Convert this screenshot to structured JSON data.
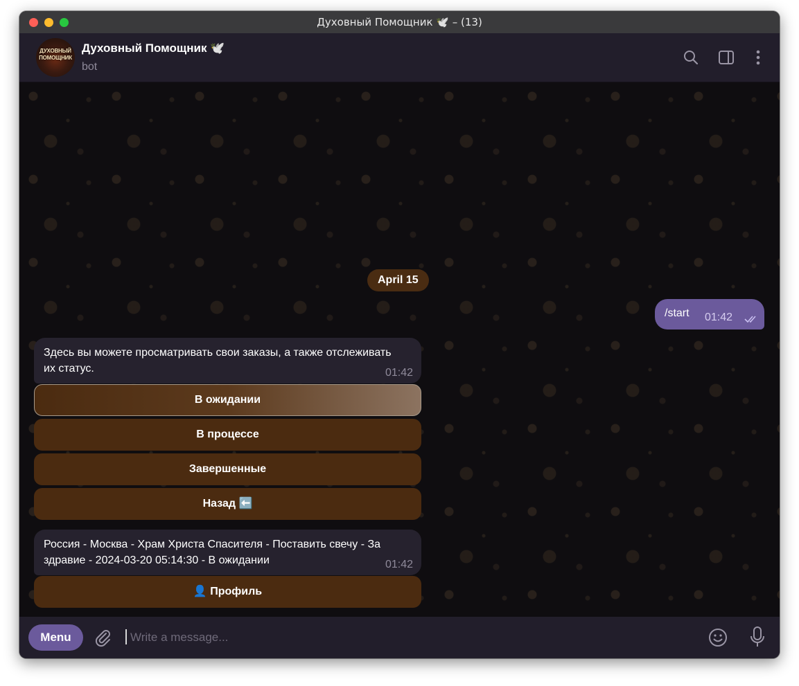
{
  "window": {
    "title": "Духовный Помощник 🕊️ – (13)"
  },
  "header": {
    "avatar_text": "ДУХОВНЫЙ ПОМОЩНИК",
    "title": "Духовный Помощник 🕊️",
    "subtitle": "bot"
  },
  "chat": {
    "date": "April 15",
    "outgoing": {
      "text": "/start",
      "time": "01:42"
    },
    "messages": [
      {
        "text": "Здесь вы можете просматривать свои заказы, а также отслеживать их статус.",
        "time": "01:42",
        "buttons": [
          {
            "label": "В ожидании",
            "selected": true
          },
          {
            "label": "В процессе"
          },
          {
            "label": "Завершенные"
          },
          {
            "label": "Назад ⬅️"
          }
        ]
      },
      {
        "text": "Россия - Москва - Храм Христа Спасителя - Поставить свечу - За здравие - 2024-03-20 05:14:30 - В ожидании",
        "time": "01:42",
        "buttons": [
          {
            "label": "👤 Профиль"
          }
        ]
      }
    ]
  },
  "composer": {
    "menu_label": "Menu",
    "placeholder": "Write a message..."
  },
  "colors": {
    "accent": "#6b5a9c",
    "button_bg": "#4b2b10",
    "date_pill": "#4a2c12",
    "chat_bg": "#0f0d10"
  },
  "icons": {
    "header": [
      "search-icon",
      "sidebar-toggle-icon",
      "more-vertical-icon"
    ],
    "composer": [
      "attach-icon",
      "emoji-icon",
      "microphone-icon"
    ],
    "status": "double-check-icon"
  }
}
